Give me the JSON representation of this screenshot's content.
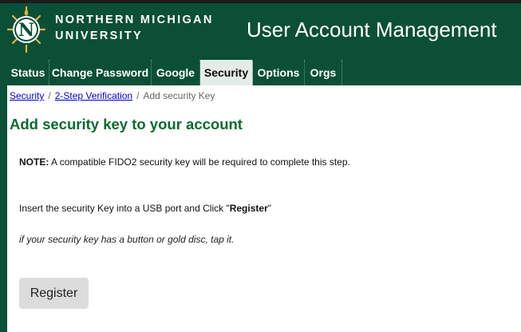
{
  "header": {
    "org_line1": "NORTHERN MICHIGAN",
    "org_line2": "UNIVERSITY",
    "logo_letter": "N",
    "app_title": "User Account Management"
  },
  "tabs": [
    {
      "label": "Status",
      "active": false
    },
    {
      "label": "Change Password",
      "active": false
    },
    {
      "label": "Google",
      "active": false
    },
    {
      "label": "Security",
      "active": true
    },
    {
      "label": "Options",
      "active": false
    },
    {
      "label": "Orgs",
      "active": false
    }
  ],
  "breadcrumb": {
    "items": [
      "Security",
      "2-Step Verification"
    ],
    "separator": "/",
    "current": "Add security Key"
  },
  "main": {
    "title": "Add security key to your account",
    "note_label": "NOTE:",
    "note_text": " A compatible FIDO2 security key will be required to complete this step.",
    "instruction_prefix": "Insert the security Key into a USB port and Click \"",
    "instruction_bold": "Register",
    "instruction_suffix": "\"",
    "hint": "if your security key has a button or gold disc, tap it.",
    "register_label": "Register"
  },
  "colors": {
    "brand_green": "#0b5036",
    "title_green": "#0a6b2c",
    "logo_gold": "#e6b23a",
    "link_blue": "#0000cc",
    "active_tab_bg": "#e4ece8"
  }
}
